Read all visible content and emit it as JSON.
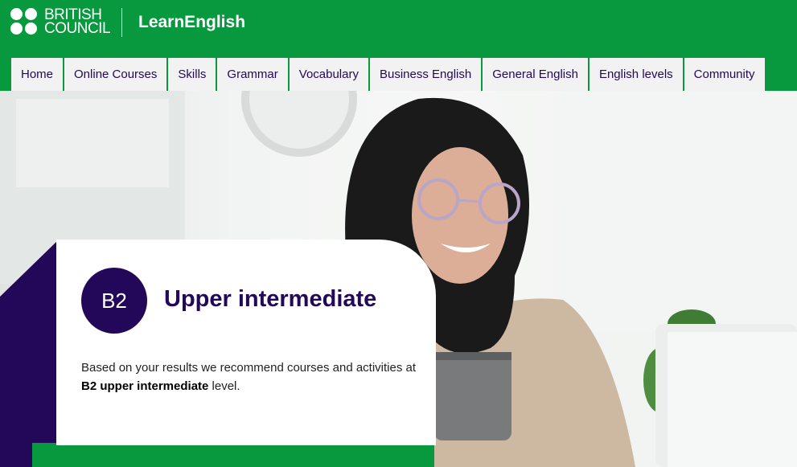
{
  "header": {
    "logo_line1": "BRITISH",
    "logo_line2": "COUNCIL",
    "site_name": "LearnEnglish"
  },
  "nav": {
    "items": [
      {
        "label": "Home"
      },
      {
        "label": "Online Courses"
      },
      {
        "label": "Skills"
      },
      {
        "label": "Grammar"
      },
      {
        "label": "Vocabulary"
      },
      {
        "label": "Business English"
      },
      {
        "label": "General English"
      },
      {
        "label": "English levels"
      },
      {
        "label": "Community"
      }
    ]
  },
  "result_card": {
    "level_code": "B2",
    "level_title": "Upper intermediate",
    "desc_prefix": "Based on your results we recommend courses and activities at ",
    "desc_bold": "B2 upper intermediate",
    "desc_suffix": " level."
  },
  "colors": {
    "brand_green": "#08983d",
    "brand_purple": "#23085a",
    "nav_bg": "#f2f2f2"
  }
}
